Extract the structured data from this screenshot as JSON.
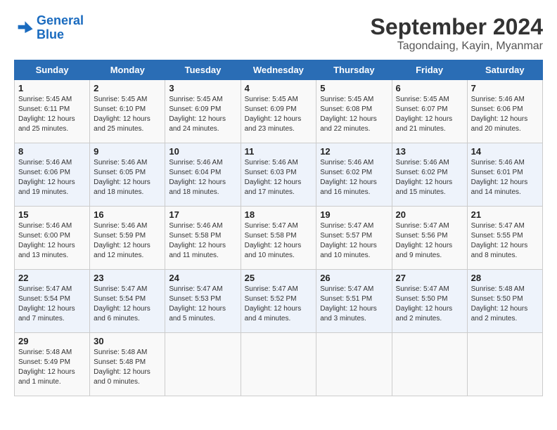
{
  "header": {
    "logo_line1": "General",
    "logo_line2": "Blue",
    "month": "September 2024",
    "location": "Tagondaing, Kayin, Myanmar"
  },
  "columns": [
    "Sunday",
    "Monday",
    "Tuesday",
    "Wednesday",
    "Thursday",
    "Friday",
    "Saturday"
  ],
  "weeks": [
    [
      {
        "day": "1",
        "detail": "Sunrise: 5:45 AM\nSunset: 6:11 PM\nDaylight: 12 hours\nand 25 minutes."
      },
      {
        "day": "2",
        "detail": "Sunrise: 5:45 AM\nSunset: 6:10 PM\nDaylight: 12 hours\nand 25 minutes."
      },
      {
        "day": "3",
        "detail": "Sunrise: 5:45 AM\nSunset: 6:09 PM\nDaylight: 12 hours\nand 24 minutes."
      },
      {
        "day": "4",
        "detail": "Sunrise: 5:45 AM\nSunset: 6:09 PM\nDaylight: 12 hours\nand 23 minutes."
      },
      {
        "day": "5",
        "detail": "Sunrise: 5:45 AM\nSunset: 6:08 PM\nDaylight: 12 hours\nand 22 minutes."
      },
      {
        "day": "6",
        "detail": "Sunrise: 5:45 AM\nSunset: 6:07 PM\nDaylight: 12 hours\nand 21 minutes."
      },
      {
        "day": "7",
        "detail": "Sunrise: 5:46 AM\nSunset: 6:06 PM\nDaylight: 12 hours\nand 20 minutes."
      }
    ],
    [
      {
        "day": "8",
        "detail": "Sunrise: 5:46 AM\nSunset: 6:06 PM\nDaylight: 12 hours\nand 19 minutes."
      },
      {
        "day": "9",
        "detail": "Sunrise: 5:46 AM\nSunset: 6:05 PM\nDaylight: 12 hours\nand 18 minutes."
      },
      {
        "day": "10",
        "detail": "Sunrise: 5:46 AM\nSunset: 6:04 PM\nDaylight: 12 hours\nand 18 minutes."
      },
      {
        "day": "11",
        "detail": "Sunrise: 5:46 AM\nSunset: 6:03 PM\nDaylight: 12 hours\nand 17 minutes."
      },
      {
        "day": "12",
        "detail": "Sunrise: 5:46 AM\nSunset: 6:02 PM\nDaylight: 12 hours\nand 16 minutes."
      },
      {
        "day": "13",
        "detail": "Sunrise: 5:46 AM\nSunset: 6:02 PM\nDaylight: 12 hours\nand 15 minutes."
      },
      {
        "day": "14",
        "detail": "Sunrise: 5:46 AM\nSunset: 6:01 PM\nDaylight: 12 hours\nand 14 minutes."
      }
    ],
    [
      {
        "day": "15",
        "detail": "Sunrise: 5:46 AM\nSunset: 6:00 PM\nDaylight: 12 hours\nand 13 minutes."
      },
      {
        "day": "16",
        "detail": "Sunrise: 5:46 AM\nSunset: 5:59 PM\nDaylight: 12 hours\nand 12 minutes."
      },
      {
        "day": "17",
        "detail": "Sunrise: 5:46 AM\nSunset: 5:58 PM\nDaylight: 12 hours\nand 11 minutes."
      },
      {
        "day": "18",
        "detail": "Sunrise: 5:47 AM\nSunset: 5:58 PM\nDaylight: 12 hours\nand 10 minutes."
      },
      {
        "day": "19",
        "detail": "Sunrise: 5:47 AM\nSunset: 5:57 PM\nDaylight: 12 hours\nand 10 minutes."
      },
      {
        "day": "20",
        "detail": "Sunrise: 5:47 AM\nSunset: 5:56 PM\nDaylight: 12 hours\nand 9 minutes."
      },
      {
        "day": "21",
        "detail": "Sunrise: 5:47 AM\nSunset: 5:55 PM\nDaylight: 12 hours\nand 8 minutes."
      }
    ],
    [
      {
        "day": "22",
        "detail": "Sunrise: 5:47 AM\nSunset: 5:54 PM\nDaylight: 12 hours\nand 7 minutes."
      },
      {
        "day": "23",
        "detail": "Sunrise: 5:47 AM\nSunset: 5:54 PM\nDaylight: 12 hours\nand 6 minutes."
      },
      {
        "day": "24",
        "detail": "Sunrise: 5:47 AM\nSunset: 5:53 PM\nDaylight: 12 hours\nand 5 minutes."
      },
      {
        "day": "25",
        "detail": "Sunrise: 5:47 AM\nSunset: 5:52 PM\nDaylight: 12 hours\nand 4 minutes."
      },
      {
        "day": "26",
        "detail": "Sunrise: 5:47 AM\nSunset: 5:51 PM\nDaylight: 12 hours\nand 3 minutes."
      },
      {
        "day": "27",
        "detail": "Sunrise: 5:47 AM\nSunset: 5:50 PM\nDaylight: 12 hours\nand 2 minutes."
      },
      {
        "day": "28",
        "detail": "Sunrise: 5:48 AM\nSunset: 5:50 PM\nDaylight: 12 hours\nand 2 minutes."
      }
    ],
    [
      {
        "day": "29",
        "detail": "Sunrise: 5:48 AM\nSunset: 5:49 PM\nDaylight: 12 hours\nand 1 minute."
      },
      {
        "day": "30",
        "detail": "Sunrise: 5:48 AM\nSunset: 5:48 PM\nDaylight: 12 hours\nand 0 minutes."
      },
      {
        "day": "",
        "detail": ""
      },
      {
        "day": "",
        "detail": ""
      },
      {
        "day": "",
        "detail": ""
      },
      {
        "day": "",
        "detail": ""
      },
      {
        "day": "",
        "detail": ""
      }
    ]
  ]
}
